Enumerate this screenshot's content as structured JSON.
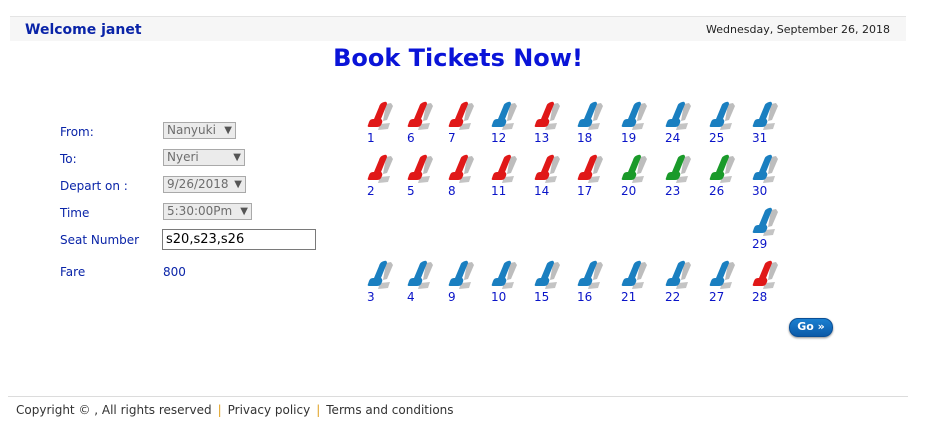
{
  "header": {
    "welcome": "Welcome janet",
    "date": "Wednesday, September 26, 2018"
  },
  "page_title": "Book Tickets Now!",
  "form": {
    "from_label": "From:",
    "from_value": "Nanyuki",
    "to_label": "To:",
    "to_value": "Nyeri",
    "depart_label": "Depart on :",
    "depart_value": "9/26/2018",
    "time_label": "Time",
    "time_value": "5:30:00Pm",
    "seat_label": "Seat Number",
    "seat_value": "s20,s23,s26",
    "fare_label": "Fare",
    "fare_value": "800"
  },
  "seat_colors": {
    "booked": "#e01818",
    "available": "#1a7fc0",
    "selected": "#1a9a2a"
  },
  "seat_rows": [
    [
      {
        "n": "1",
        "s": "booked"
      },
      {
        "n": "6",
        "s": "booked"
      },
      {
        "n": "7",
        "s": "booked"
      },
      {
        "n": "12",
        "s": "available"
      },
      {
        "n": "13",
        "s": "booked"
      },
      {
        "n": "18",
        "s": "available"
      },
      {
        "n": "19",
        "s": "available"
      },
      {
        "n": "24",
        "s": "available"
      },
      {
        "n": "25",
        "s": "available"
      },
      {
        "n": "31",
        "s": "available"
      }
    ],
    [
      {
        "n": "2",
        "s": "booked"
      },
      {
        "n": "5",
        "s": "booked"
      },
      {
        "n": "8",
        "s": "booked"
      },
      {
        "n": "11",
        "s": "booked"
      },
      {
        "n": "14",
        "s": "booked"
      },
      {
        "n": "17",
        "s": "booked"
      },
      {
        "n": "20",
        "s": "selected"
      },
      {
        "n": "23",
        "s": "selected"
      },
      {
        "n": "26",
        "s": "selected"
      },
      {
        "n": "30",
        "s": "available"
      }
    ],
    [
      {
        "n": "29",
        "s": "available"
      }
    ],
    [
      {
        "n": "3",
        "s": "available"
      },
      {
        "n": "4",
        "s": "available"
      },
      {
        "n": "9",
        "s": "available"
      },
      {
        "n": "10",
        "s": "available"
      },
      {
        "n": "15",
        "s": "available"
      },
      {
        "n": "16",
        "s": "available"
      },
      {
        "n": "21",
        "s": "available"
      },
      {
        "n": "22",
        "s": "available"
      },
      {
        "n": "27",
        "s": "available"
      },
      {
        "n": "28",
        "s": "booked"
      }
    ]
  ],
  "go_button": "Go »",
  "footer": {
    "copyright": "Copyright © , All rights reserved",
    "privacy": "Privacy policy",
    "terms": "Terms and conditions"
  }
}
